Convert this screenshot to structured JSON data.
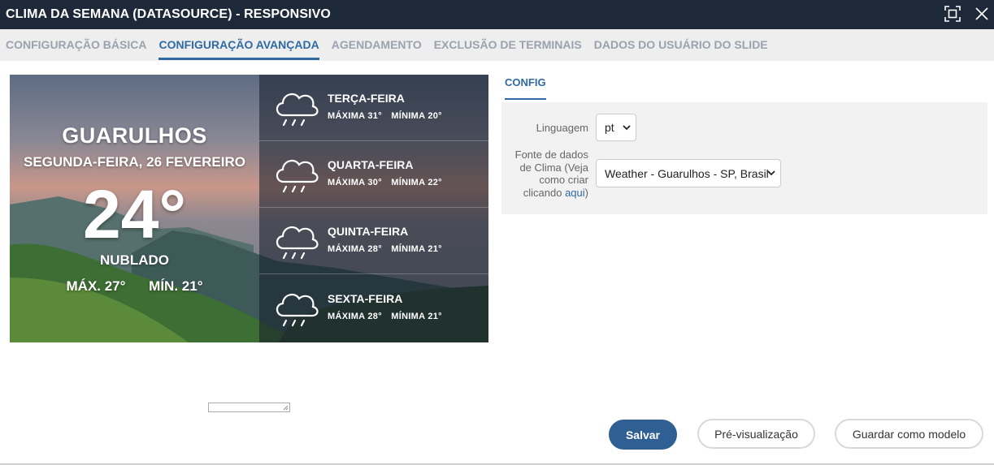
{
  "window": {
    "title": "CLIMA DA SEMANA (DATASOURCE) - RESPONSIVO",
    "expand_icon": "expand-icon",
    "close_icon": "close-icon"
  },
  "tabs": [
    {
      "label": "CONFIGURAÇÃO BÁSICA",
      "active": false
    },
    {
      "label": "CONFIGURAÇÃO AVANÇADA",
      "active": true
    },
    {
      "label": "AGENDAMENTO",
      "active": false
    },
    {
      "label": "EXCLUSÃO DE TERMINAIS",
      "active": false
    },
    {
      "label": "DADOS DO USUÁRIO DO SLIDE",
      "active": false
    }
  ],
  "preview": {
    "city": "GUARULHOS",
    "date": "SEGUNDA-FEIRA, 26 FEVEREIRO",
    "temperature": "24°",
    "condition": "NUBLADO",
    "max": "MÁX. 27°",
    "min": "MÍN. 21°",
    "forecast": [
      {
        "day": "TERÇA-FEIRA",
        "max_label": "MÁXIMA",
        "max": "31°",
        "min_label": "MÍNIMA",
        "min": "20°",
        "icon": "rain-cloud-icon"
      },
      {
        "day": "QUARTA-FEIRA",
        "max_label": "MÁXIMA",
        "max": "30°",
        "min_label": "MÍNIMA",
        "min": "22°",
        "icon": "rain-cloud-icon"
      },
      {
        "day": "QUINTA-FEIRA",
        "max_label": "MÁXIMA",
        "max": "28°",
        "min_label": "MÍNIMA",
        "min": "21°",
        "icon": "rain-cloud-icon"
      },
      {
        "day": "SEXTA-FEIRA",
        "max_label": "MÁXIMA",
        "max": "28°",
        "min_label": "MÍNIMA",
        "min": "21°",
        "icon": "rain-cloud-icon"
      }
    ]
  },
  "config": {
    "tab_label": "CONFIG",
    "language_label": "Linguagem",
    "language_value": "pt",
    "source_label": "Fonte de dados de Clima (Veja como criar clicando",
    "source_link": "aqui",
    "source_label_end": ")",
    "source_value": "Weather - Guarulhos - SP, Brasil"
  },
  "buttons": {
    "save": "Salvar",
    "preview": "Pré-visualização",
    "template": "Guardar como modelo"
  },
  "colors": {
    "titlebar": "#1d2939",
    "accent": "#2f6aa3",
    "save_button": "#2f5f93"
  }
}
